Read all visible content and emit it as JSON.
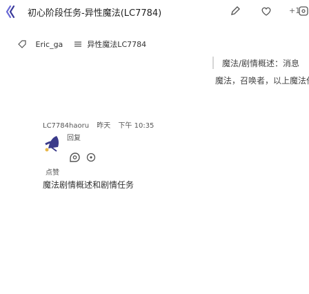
{
  "header": {
    "title": "初心阶段任务-异性魔法(LC7784)",
    "count": "+1"
  },
  "meta": {
    "user": "Eric_ga",
    "board": "异性魔法LC7784"
  },
  "quote": {
    "line1": "魔法/剧情概述：消息",
    "line2": "魔法，召唤者，以上魔法任务"
  },
  "comment": {
    "user": "LC7784haoru",
    "date": "昨天",
    "time": "下午 10:35",
    "reply_label": "回复",
    "small_label": "点赞",
    "text": "魔法剧情概述和剧情任务"
  },
  "colors": {
    "accent": "#5a5ad0",
    "text": "#333333",
    "muted": "#666666",
    "divider": "#d6d6d6"
  },
  "icons": {
    "back": "back-arrow-icon",
    "pen": "pen-icon",
    "heart": "like-icon",
    "tag": "tag-icon",
    "bar": "list-icon",
    "avatar": "avatar",
    "reply": "reply-icon",
    "more": "more-icon"
  }
}
